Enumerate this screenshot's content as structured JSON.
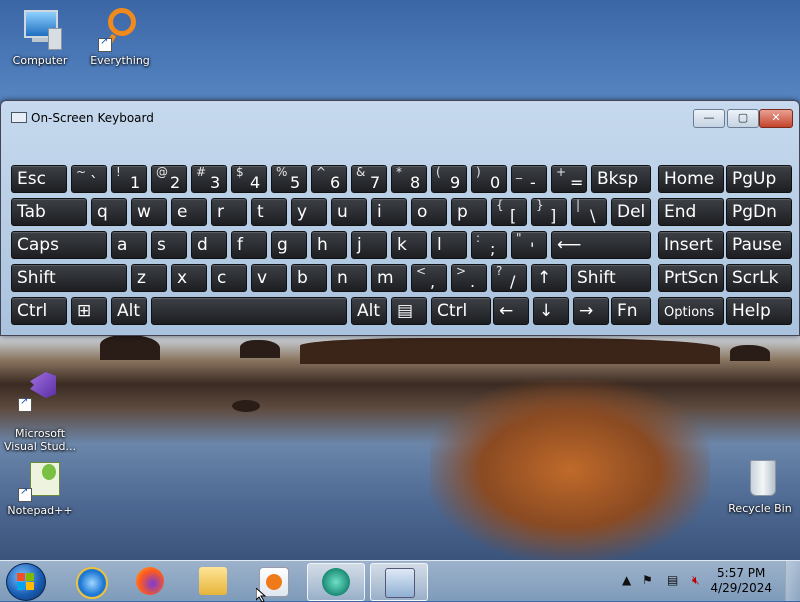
{
  "desktop": {
    "icons": [
      {
        "label": "Computer"
      },
      {
        "label": "Everything"
      },
      {
        "label": "Microsoft\nVisual Stud..."
      },
      {
        "label": "Notepad++"
      },
      {
        "label": "Recycle Bin"
      }
    ]
  },
  "window": {
    "title": "On-Screen Keyboard",
    "min_label": "—",
    "max_label": "▢",
    "close_label": "✕"
  },
  "keyboard": {
    "row1": [
      {
        "main": "Esc"
      },
      {
        "sub": "~",
        "main": "`"
      },
      {
        "sub": "!",
        "main": "1"
      },
      {
        "sub": "@",
        "main": "2"
      },
      {
        "sub": "#",
        "main": "3"
      },
      {
        "sub": "$",
        "main": "4"
      },
      {
        "sub": "%",
        "main": "5"
      },
      {
        "sub": "^",
        "main": "6"
      },
      {
        "sub": "&",
        "main": "7"
      },
      {
        "sub": "*",
        "main": "8"
      },
      {
        "sub": "(",
        "main": "9"
      },
      {
        "sub": ")",
        "main": "0"
      },
      {
        "sub": "_",
        "main": "-"
      },
      {
        "sub": "+",
        "main": "="
      },
      {
        "main": "Bksp"
      },
      {
        "main": "Home"
      },
      {
        "main": "PgUp"
      }
    ],
    "row2": [
      {
        "main": "Tab"
      },
      {
        "main": "q"
      },
      {
        "main": "w"
      },
      {
        "main": "e"
      },
      {
        "main": "r"
      },
      {
        "main": "t"
      },
      {
        "main": "y"
      },
      {
        "main": "u"
      },
      {
        "main": "i"
      },
      {
        "main": "o"
      },
      {
        "main": "p"
      },
      {
        "sub": "{",
        "main": "["
      },
      {
        "sub": "}",
        "main": "]"
      },
      {
        "sub": "|",
        "main": "\\"
      },
      {
        "main": "Del"
      },
      {
        "main": "End"
      },
      {
        "main": "PgDn"
      }
    ],
    "row3": [
      {
        "main": "Caps"
      },
      {
        "main": "a"
      },
      {
        "main": "s"
      },
      {
        "main": "d"
      },
      {
        "main": "f"
      },
      {
        "main": "g"
      },
      {
        "main": "h"
      },
      {
        "main": "j"
      },
      {
        "main": "k"
      },
      {
        "main": "l"
      },
      {
        "sub": ":",
        "main": ";"
      },
      {
        "sub": "\"",
        "main": "'"
      },
      {
        "main": "⟵"
      },
      {
        "main": "Insert"
      },
      {
        "main": "Pause"
      }
    ],
    "row4": [
      {
        "main": "Shift"
      },
      {
        "main": "z"
      },
      {
        "main": "x"
      },
      {
        "main": "c"
      },
      {
        "main": "v"
      },
      {
        "main": "b"
      },
      {
        "main": "n"
      },
      {
        "main": "m"
      },
      {
        "sub": "<",
        "main": ","
      },
      {
        "sub": ">",
        "main": "."
      },
      {
        "sub": "?",
        "main": "/"
      },
      {
        "main": "↑"
      },
      {
        "main": "Shift"
      },
      {
        "main": "PrtScn"
      },
      {
        "main": "ScrLk"
      }
    ],
    "row5": [
      {
        "main": "Ctrl"
      },
      {
        "main": "⊞"
      },
      {
        "main": "Alt"
      },
      {
        "main": ""
      },
      {
        "main": "Alt"
      },
      {
        "main": "▤"
      },
      {
        "main": "Ctrl"
      },
      {
        "main": "←"
      },
      {
        "main": "↓"
      },
      {
        "main": "→"
      },
      {
        "main": "Fn"
      },
      {
        "main": "Options"
      },
      {
        "main": "Help"
      }
    ]
  },
  "taskbar": {
    "time": "5:57 PM",
    "date": "4/29/2024",
    "tray_expand": "▲"
  },
  "colors": {
    "key_bg": "#1c1e22",
    "window_frame": "#a9c2dd",
    "close_button": "#c4442c"
  }
}
